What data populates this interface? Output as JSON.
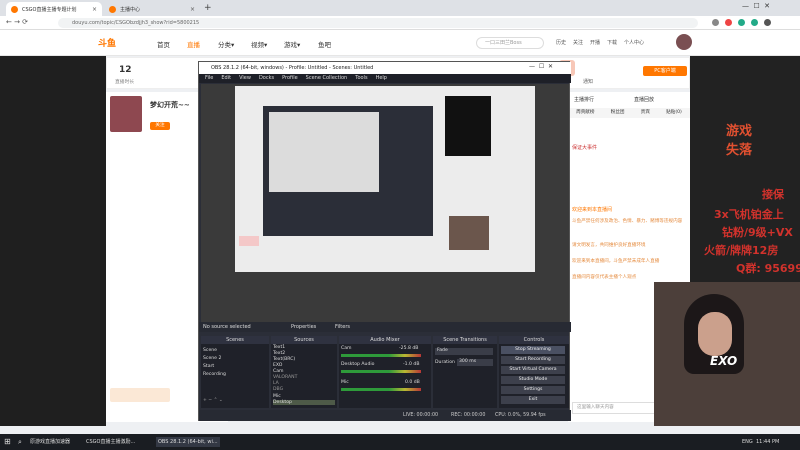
{
  "browser": {
    "tabs": [
      {
        "label": "CSGO直播主播专题计划"
      },
      {
        "label": "主播中心"
      }
    ],
    "new_tab": "+",
    "url": "douyu.com/topic/CSGObzdjjh3_show?rid=5800215"
  },
  "site": {
    "logo": "斗鱼",
    "nav": [
      "首页",
      "直播",
      "分类▾",
      "视频▾",
      "游戏▾",
      "鱼吧"
    ],
    "search_placeholder": "一口三田兰Boss",
    "header_icons": [
      "历史",
      "关注",
      "开播",
      "下载",
      "个人中心"
    ]
  },
  "room": {
    "count": "12",
    "count_label": "直播时长",
    "streamer": "梦幻开荒~~",
    "follow": "关注",
    "tags": [
      "直播间"
    ],
    "right_button": "PC客户端",
    "right_label": "通知"
  },
  "chat": {
    "tabs": [
      "主播排行",
      "直播回放"
    ],
    "subtabs": [
      "周贡献榜",
      "粉丝团",
      "贵宾",
      "贴贴(0)"
    ],
    "event": "保证大事件",
    "welcome": "欢迎来到本直播间",
    "messages": [
      "斗鱼严禁任何涉及政治、色情、暴力、赌博等违规内容",
      "请文明发言，共同维护良好直播环境",
      "欢迎来到本直播间，斗鱼严禁未成年人直播",
      "直播间内容仅代表主播个人观点"
    ],
    "input_placeholder": "这里输入聊天内容",
    "send": "发送"
  },
  "promo": {
    "lines": [
      "游戏",
      "失落",
      "接保",
      "3x飞机铂金上",
      "钻粉/9级+VX",
      "火箭/牌牌12房",
      "Q群: 956995"
    ]
  },
  "obs": {
    "title": "OBS 28.1.2 (64-bit, windows) - Profile: Untitled - Scenes: Untitled",
    "menu": [
      "File",
      "Edit",
      "View",
      "Docks",
      "Profile",
      "Scene Collection",
      "Tools",
      "Help"
    ],
    "no_source": "No source selected",
    "props": "Properties",
    "filters": "Filters",
    "docks": {
      "scenes": {
        "title": "Scenes",
        "items": [
          "Scene",
          "Scene 2",
          "Start",
          "Recording"
        ]
      },
      "sources": {
        "title": "Sources",
        "items": [
          "Text1",
          "Text2",
          "Text(BRC)",
          "EXO",
          "Cam",
          "VALORANT",
          "LA",
          "DBG",
          "Ocean",
          "Phone",
          "RAFT",
          "CSGO",
          "Mic",
          "Desktop"
        ]
      },
      "mixer": {
        "title": "Audio Mixer",
        "channels": [
          {
            "name": "Cam",
            "db": "-25.8 dB"
          },
          {
            "name": "Desktop Audio",
            "db": "-1.0 dB"
          },
          {
            "name": "Mic",
            "db": "0.0 dB"
          }
        ]
      },
      "transitions": {
        "title": "Scene Transitions",
        "type": "Fade",
        "duration_label": "Duration",
        "duration": "300 ms"
      },
      "controls": {
        "title": "Controls",
        "buttons": [
          "Stop Streaming",
          "Start Recording",
          "Start Virtual Camera",
          "Studio Mode",
          "Settings",
          "Exit"
        ]
      }
    },
    "status": {
      "live": "LIVE: 00:00:00",
      "rec": "REC: 00:00:00",
      "cpu": "CPU: 0.0%, 59.94 fps"
    }
  },
  "cam_watermark": "EXO",
  "taskbar": {
    "items": [
      "原游戏直播加速器",
      "CSGO直播主播激励...",
      "OBS 28.1.2 (64-bit, wi..."
    ],
    "lang": "ENG",
    "time": "11:44 PM"
  }
}
